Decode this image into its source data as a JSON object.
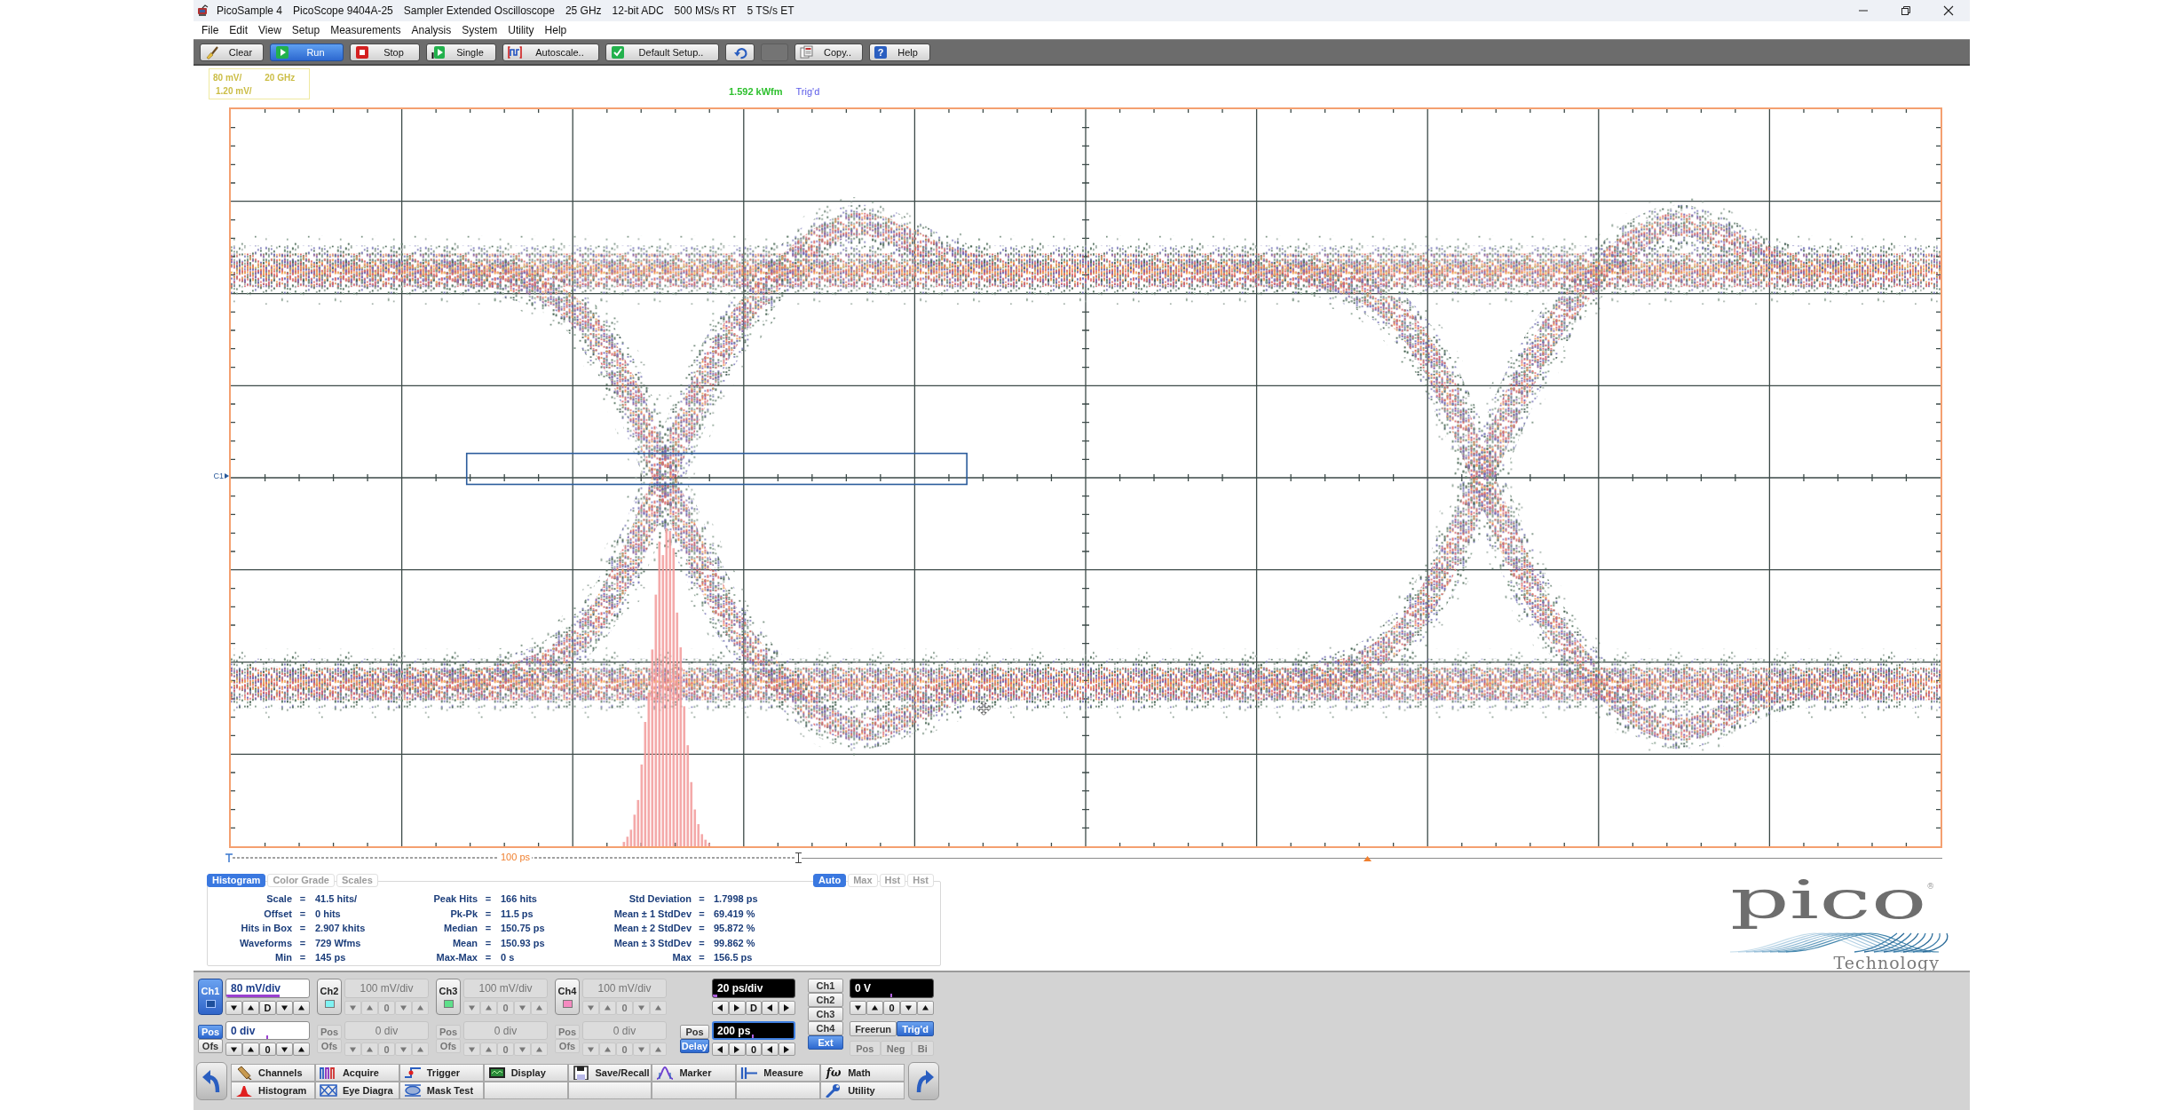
{
  "window": {
    "title": [
      "PicoSample 4",
      "PicoScope 9404A-25",
      "Sampler Extended Oscilloscope",
      "25 GHz",
      "12-bit ADC",
      "500 MS/s RT",
      "5 TS/s ET"
    ]
  },
  "menu": [
    "File",
    "Edit",
    "View",
    "Setup",
    "Measurements",
    "Analysis",
    "System",
    "Utility",
    "Help"
  ],
  "toolbar": [
    {
      "kind": "brush",
      "label": "Clear",
      "on": false
    },
    {
      "kind": "play",
      "label": "Run",
      "on": true
    },
    {
      "kind": "stop",
      "label": "Stop",
      "on": false
    },
    {
      "kind": "single",
      "label": "Single",
      "on": false
    },
    {
      "kind": "autoscale",
      "label": "Autoscale..",
      "on": false
    },
    {
      "kind": "check",
      "label": "Default Setup..",
      "on": false
    },
    {
      "kind": "undo",
      "on": false
    },
    {
      "kind": "blank",
      "on": false
    },
    {
      "kind": "copy",
      "label": "Copy..",
      "on": false
    },
    {
      "kind": "help",
      "label": "Help",
      "glyph": "?",
      "on": false
    }
  ],
  "readout": {
    "lines": [
      [
        "80 mV/",
        "20 GHz"
      ],
      [
        "1.20 mV/"
      ]
    ]
  },
  "status": {
    "acquisitions": "1.592 kWfm",
    "trigger": "Trig'd"
  },
  "plot": {
    "channel_label": "C1",
    "time_scale": "100 ps"
  },
  "histogram_panel": {
    "tabs": [
      {
        "label": "Histogram",
        "selected": true
      },
      {
        "label": "Color Grade",
        "selected": false
      },
      {
        "label": "Scales",
        "selected": false
      }
    ],
    "modes": [
      {
        "label": "Auto",
        "selected": true
      },
      {
        "label": "Max",
        "selected": false
      },
      {
        "label": "Hst",
        "selected": false
      },
      {
        "label": "Hst",
        "selected": false
      }
    ],
    "columns": [
      [
        {
          "label": "Scale",
          "sign": "=",
          "value": "41.5 hits/"
        },
        {
          "label": "Offset",
          "sign": "=",
          "value": "0 hits"
        },
        {
          "label": "Hits in Box",
          "sign": "=",
          "value": "2.907 khits"
        },
        {
          "label": "Waveforms",
          "sign": "=",
          "value": "729 Wfms"
        },
        {
          "label": "Min",
          "sign": "=",
          "value": "145 ps"
        }
      ],
      [
        {
          "label": "Peak Hits",
          "sign": "=",
          "value": "166 hits"
        },
        {
          "label": "Pk-Pk",
          "sign": "=",
          "value": "11.5 ps"
        },
        {
          "label": "Median",
          "sign": "=",
          "value": "150.75 ps"
        },
        {
          "label": "Mean",
          "sign": "=",
          "value": "150.93 ps"
        },
        {
          "label": "Max-Max",
          "sign": "=",
          "value": "0 s"
        }
      ],
      [
        {
          "label": "Std Deviation",
          "sign": "=",
          "value": "1.7998 ps"
        },
        {
          "label": "Mean ± 1 StdDev",
          "sign": "=",
          "value": "69.419 %"
        },
        {
          "label": "Mean ± 2 StdDev",
          "sign": "=",
          "value": "95.872 %"
        },
        {
          "label": "Mean ± 3 StdDev",
          "sign": "=",
          "value": "99.862 %"
        },
        {
          "label": "Max",
          "sign": "=",
          "value": "156.5 ps"
        }
      ]
    ]
  },
  "logo": {
    "name": "pico",
    "mark": "®",
    "tagline": "Technology"
  },
  "channels": [
    {
      "name": "Ch1",
      "color": "#1d4f9c",
      "selected": true,
      "on": true,
      "scale": {
        "value": "80 mV/div",
        "level": 0.65,
        "step": "D"
      },
      "offset_modes": [
        {
          "label": "Pos",
          "selected": true
        },
        {
          "label": "Ofs",
          "selected": false
        }
      ],
      "offset": {
        "value": "0 div",
        "level": 0.49,
        "step": "0"
      }
    },
    {
      "name": "Ch2",
      "color": "#7ff2f2",
      "selected": false,
      "on": false,
      "scale": {
        "value": "100 mV/div",
        "step": "0"
      },
      "offset_modes": [
        {
          "label": "Pos",
          "selected": false
        },
        {
          "label": "Ofs",
          "selected": false
        }
      ],
      "offset": {
        "value": "0 div",
        "step": "0"
      }
    },
    {
      "name": "Ch3",
      "color": "#5ee08a",
      "selected": false,
      "on": false,
      "scale": {
        "value": "100 mV/div",
        "step": "0"
      },
      "offset_modes": [
        {
          "label": "Pos",
          "selected": false
        },
        {
          "label": "Ofs",
          "selected": false
        }
      ],
      "offset": {
        "value": "0 div",
        "step": "0"
      }
    },
    {
      "name": "Ch4",
      "color": "#f58ac0",
      "selected": false,
      "on": false,
      "scale": {
        "value": "100 mV/div",
        "step": "0"
      },
      "offset_modes": [
        {
          "label": "Pos",
          "selected": false
        },
        {
          "label": "Ofs",
          "selected": false
        }
      ],
      "offset": {
        "value": "0 div",
        "step": "0"
      }
    }
  ],
  "timebase": {
    "scale": {
      "value": "20 ps/div",
      "level": 0.05,
      "step": "D",
      "focused": false
    },
    "modes": [
      {
        "label": "Pos",
        "selected": false
      },
      {
        "label": "Delay",
        "selected": true
      }
    ],
    "delay": {
      "value": "200 ps",
      "level": 0.49,
      "step": "0",
      "focused": true
    }
  },
  "trigger": {
    "sources": [
      {
        "label": "Ch1",
        "selected": false
      },
      {
        "label": "Ch2",
        "selected": false
      },
      {
        "label": "Ch3",
        "selected": false
      },
      {
        "label": "Ch4",
        "selected": false
      },
      {
        "label": "Ext",
        "selected": true
      }
    ],
    "threshold": {
      "value": "0 V",
      "level": 0.49,
      "step": "0",
      "focused": false
    },
    "modes": [
      {
        "label": "Freerun",
        "selected": false
      },
      {
        "label": "Trig'd",
        "selected": true
      }
    ],
    "slopes": [
      {
        "label": "Pos",
        "selected": false,
        "disabled": true
      },
      {
        "label": "Neg",
        "selected": false,
        "disabled": true
      },
      {
        "label": "Bi",
        "selected": false,
        "disabled": true
      }
    ]
  },
  "navigation": [
    [
      {
        "kind": "channels",
        "label": "Channels"
      },
      {
        "kind": "acquire",
        "label": "Acquire"
      },
      {
        "kind": "trigger",
        "label": "Trigger"
      },
      {
        "kind": "display",
        "label": "Display"
      },
      {
        "kind": "save",
        "label": "Save/Recall"
      },
      {
        "kind": "marker",
        "label": "Marker"
      },
      {
        "kind": "measure",
        "label": "Measure"
      },
      {
        "kind": "math",
        "label": "Math",
        "glyph": "fω"
      }
    ],
    [
      {
        "kind": "histogram",
        "label": "Histogram"
      },
      {
        "kind": "eye",
        "label": "Eye Diagra"
      },
      {
        "kind": "mask",
        "label": "Mask Test"
      },
      {
        "kind": "blank"
      },
      {
        "kind": "blank"
      },
      {
        "kind": "blank"
      },
      {
        "kind": "blank"
      },
      {
        "kind": "utility",
        "label": "Utility"
      }
    ]
  ]
}
